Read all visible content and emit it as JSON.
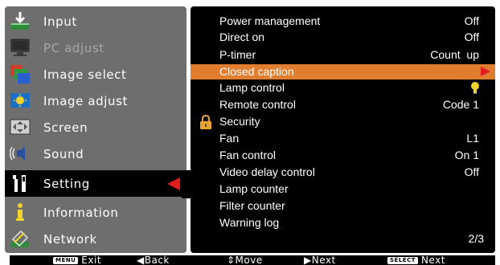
{
  "left_menu": {
    "items": [
      {
        "label": "Input",
        "icon": "input-icon",
        "state": "normal"
      },
      {
        "label": "PC adjust",
        "icon": "monitor-icon",
        "state": "disabled"
      },
      {
        "label": "Image select",
        "icon": "image-select-icon",
        "state": "normal"
      },
      {
        "label": "Image adjust",
        "icon": "image-adjust-icon",
        "state": "normal"
      },
      {
        "label": "Screen",
        "icon": "screen-icon",
        "state": "normal"
      },
      {
        "label": "Sound",
        "icon": "speaker-icon",
        "state": "normal"
      },
      {
        "label": "Setting",
        "icon": "setting-icon",
        "state": "selected"
      },
      {
        "label": "Information",
        "icon": "info-icon",
        "state": "normal"
      },
      {
        "label": "Network",
        "icon": "network-icon",
        "state": "normal"
      }
    ]
  },
  "settings_list": {
    "rows": [
      {
        "name": "Power management",
        "value": "Off"
      },
      {
        "name": "Direct on",
        "value": "Off"
      },
      {
        "name": "P-timer",
        "value": "Count  up"
      },
      {
        "name": "Closed caption",
        "value": ""
      },
      {
        "name": "Lamp control",
        "value": ""
      },
      {
        "name": "Remote control",
        "value": "Code 1"
      },
      {
        "name": "Security",
        "value": ""
      },
      {
        "name": "Fan",
        "value": "L1"
      },
      {
        "name": "Fan control",
        "value": "On 1"
      },
      {
        "name": "Video delay control",
        "value": "Off"
      },
      {
        "name": "Lamp counter",
        "value": ""
      },
      {
        "name": "Filter counter",
        "value": ""
      },
      {
        "name": "Warning log",
        "value": ""
      }
    ],
    "page": "2/3"
  },
  "footer": {
    "menu_tag": "MENU",
    "exit": "Exit",
    "back": "◀Back",
    "move": "⇕Move",
    "next": "▶Next",
    "select_tag": "SELECT",
    "select_next": "Next"
  },
  "colors": {
    "left_panel": "#6e6e6e",
    "right_panel": "#000000",
    "highlight": "#e07d2e",
    "arrow": "#e11c1c"
  }
}
